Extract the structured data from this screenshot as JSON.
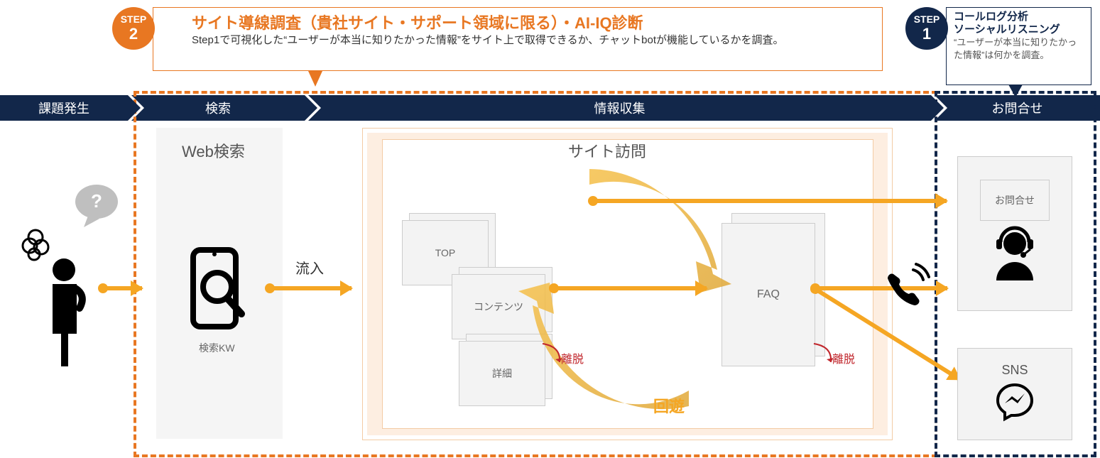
{
  "steps": {
    "step2": {
      "badge_top": "STEP",
      "badge_num": "2",
      "title": "サイト導線調査（貴社サイト・サポート領域に限る）・AI-IQ診断",
      "desc": "Step1で可視化した“ユーザーが本当に知りたかった情報”をサイト上で取得できるか、チャットbotが機能しているかを調査。"
    },
    "step1": {
      "badge_top": "STEP",
      "badge_num": "1",
      "title_line1": "コールログ分析",
      "title_line2": "ソーシャルリスニング",
      "desc": "“ユーザーが本当に知りたかった情報”は何かを調査。"
    }
  },
  "ribbon": {
    "seg1": "課題発生",
    "seg2": "検索",
    "seg3": "情報収集",
    "seg4": "お問合せ"
  },
  "zones": {
    "search_heading": "Web検索",
    "search_caption": "検索KW",
    "inflow_label": "流入",
    "visit_heading": "サイト訪問",
    "pages": {
      "top": "TOP",
      "contents": "コンテンツ",
      "detail": "詳細",
      "faq": "FAQ"
    },
    "roam_label": "回遊",
    "exit_label": "離脱"
  },
  "right": {
    "contact_label": "お問合せ",
    "sns_label": "SNS"
  },
  "colors": {
    "orange": "#e87722",
    "navy": "#12274a",
    "arrow": "#f5a623",
    "red": "#c1272d"
  }
}
